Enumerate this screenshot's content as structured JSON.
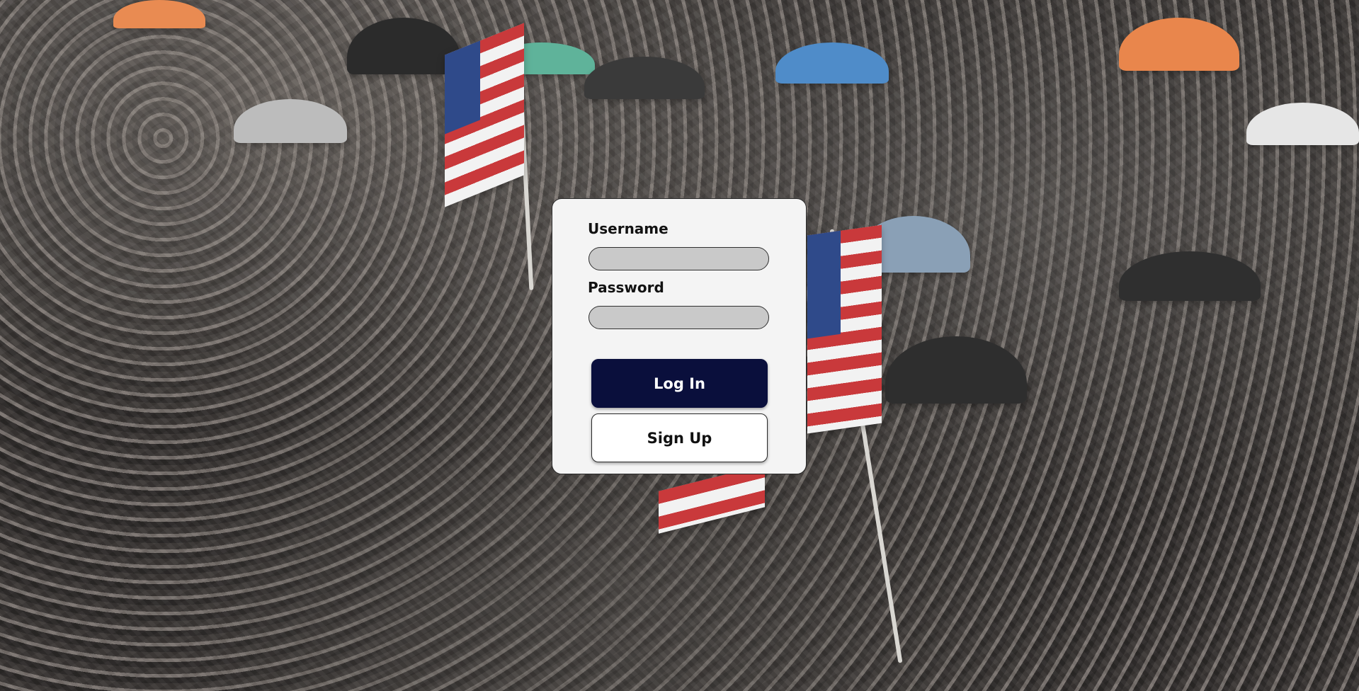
{
  "login_form": {
    "username_label": "Username",
    "password_label": "Password",
    "username_value": "",
    "password_value": "",
    "login_button_label": "Log In",
    "signup_button_label": "Sign Up"
  },
  "colors": {
    "login_button_bg": "#0a0f3c",
    "card_bg": "#f4f4f4",
    "input_bg": "#c9c9c9"
  }
}
